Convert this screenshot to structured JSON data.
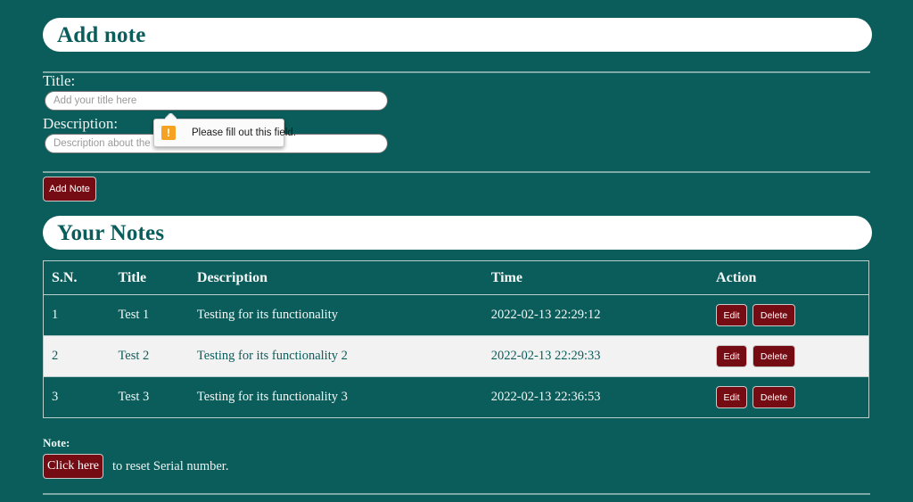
{
  "theme": {
    "background": "#0b5d5b",
    "pill_background": "#ffffff",
    "heading_color": "#0b5d5b",
    "button_maroon": "#750c13",
    "divider_color": "#7fa9a7",
    "table_border": "#b9cfce",
    "alt_row_background": "#f2f2f2",
    "warning_icon_color": "#f5a222"
  },
  "add_note_section": {
    "heading": "Add note",
    "title_label": "Title:",
    "title_input": {
      "value": "",
      "placeholder": "Add your title here"
    },
    "description_label": "Description:",
    "description_input": {
      "value": "",
      "placeholder": "Description about the note"
    },
    "submit_label": "Add Note"
  },
  "validation_tooltip": {
    "message": "Please fill out this field.",
    "icon": "warning-exclamation-icon",
    "icon_glyph": "!"
  },
  "notes_section": {
    "heading": "Your Notes",
    "columns": [
      "S.N.",
      "Title",
      "Description",
      "Time",
      "Action"
    ],
    "rows": [
      {
        "sn": "1",
        "title": "Test 1",
        "description": "Testing for its functionality",
        "time": "2022-02-13 22:29:12",
        "edit_label": "Edit",
        "delete_label": "Delete"
      },
      {
        "sn": "2",
        "title": "Test 2",
        "description": "Testing for its functionality 2",
        "time": "2022-02-13 22:29:33",
        "edit_label": "Edit",
        "delete_label": "Delete"
      },
      {
        "sn": "3",
        "title": "Test 3",
        "description": "Testing for its functionality 3",
        "time": "2022-02-13 22:36:53",
        "edit_label": "Edit",
        "delete_label": "Delete"
      }
    ]
  },
  "footer": {
    "note_label": "Note:",
    "reset_button_label": "Click here",
    "reset_caption": "to reset Serial number."
  }
}
